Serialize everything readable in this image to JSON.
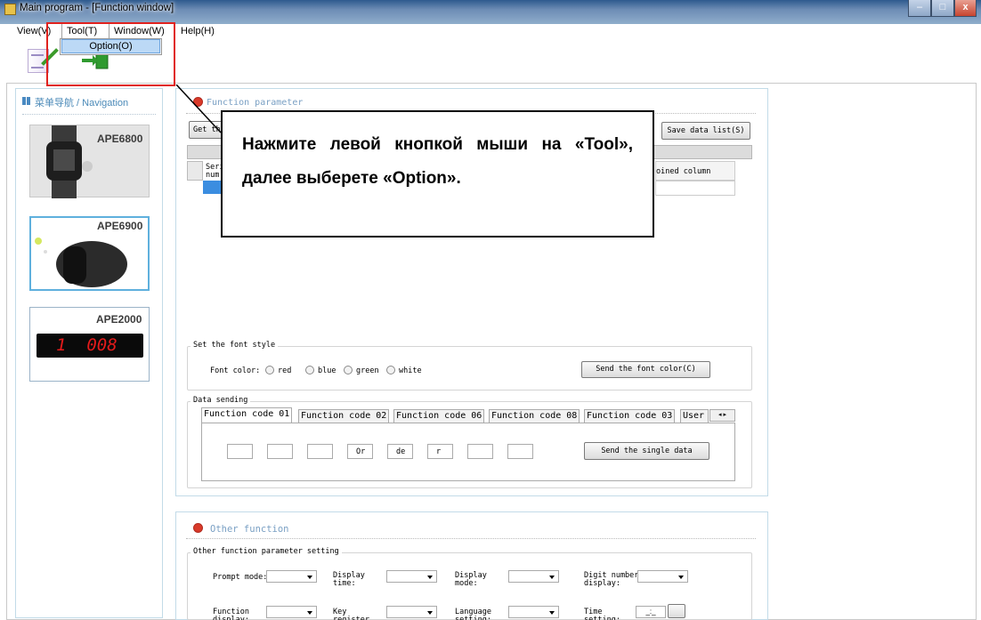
{
  "window": {
    "title": "Main program - [Function window]",
    "minimize": "–",
    "maximize": "□",
    "close": "x"
  },
  "menu": {
    "view": "View(V)",
    "tool": "Tool(T)",
    "window": "Window(W)",
    "help": "Help(H)",
    "option": "Option(O)"
  },
  "nav": {
    "title": "菜单导航 / Navigation",
    "items": [
      {
        "label": "APE6800"
      },
      {
        "label": "APE6900"
      },
      {
        "label": "APE2000"
      }
    ],
    "display_digits": "1  008"
  },
  "function_parameter": {
    "title": "Function parameter",
    "get_button": "Get th",
    "save_button": "Save data list(S)",
    "grid_col_serial": "Seri",
    "grid_col_serial2": "num",
    "grid_col_joined": "oined column"
  },
  "callout": {
    "text": "Нажмите левой кнопкой мыши на «Tool», далее выберете «Option»."
  },
  "font_style": {
    "group_title": "Set the font style",
    "label": "Font color:",
    "options": [
      {
        "label": "red"
      },
      {
        "label": "blue"
      },
      {
        "label": "green"
      },
      {
        "label": "white"
      }
    ],
    "send_button": "Send the font color(C)"
  },
  "data_sending": {
    "group_title": "Data sending",
    "tabs": [
      {
        "label": "Function code 01"
      },
      {
        "label": "Function code 02"
      },
      {
        "label": "Function code 06"
      },
      {
        "label": "Function code 08"
      },
      {
        "label": "Function code 03"
      },
      {
        "label": "User"
      }
    ],
    "inputs": [
      {
        "value": ""
      },
      {
        "value": ""
      },
      {
        "value": ""
      },
      {
        "value": "Or"
      },
      {
        "value": "de"
      },
      {
        "value": "r"
      },
      {
        "value": ""
      },
      {
        "value": ""
      }
    ],
    "send_button": "Send the single data"
  },
  "other": {
    "title": "Other function",
    "group_title": "Other function parameter setting",
    "row1": [
      {
        "label": "Prompt mode:"
      },
      {
        "label": "Display time:"
      },
      {
        "label": "Display mode:"
      },
      {
        "label": "Digit number display:"
      }
    ],
    "row2": [
      {
        "label": "Function display:"
      },
      {
        "label": "Key register mode:"
      },
      {
        "label": "Language setting:"
      },
      {
        "label": "Time setting:"
      }
    ]
  }
}
